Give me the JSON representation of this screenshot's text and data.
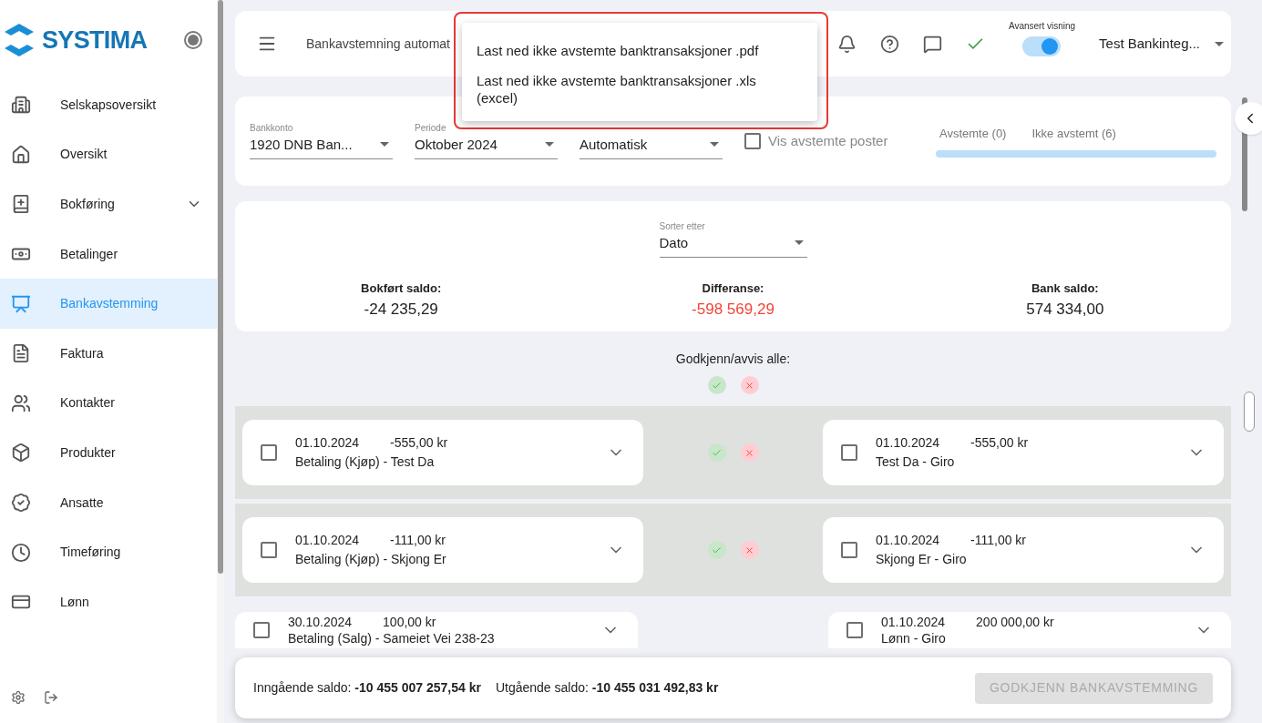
{
  "brand": "SYSTIMA",
  "sidebar": {
    "items": [
      {
        "label": "Selskapsoversikt",
        "selected": false,
        "expandable": false
      },
      {
        "label": "Oversikt",
        "selected": false,
        "expandable": false
      },
      {
        "label": "Bokføring",
        "selected": false,
        "expandable": true
      },
      {
        "label": "Betalinger",
        "selected": false,
        "expandable": false
      },
      {
        "label": "Bankavstemming",
        "selected": true,
        "expandable": false
      },
      {
        "label": "Faktura",
        "selected": false,
        "expandable": false
      },
      {
        "label": "Kontakter",
        "selected": false,
        "expandable": false
      },
      {
        "label": "Produkter",
        "selected": false,
        "expandable": false
      },
      {
        "label": "Ansatte",
        "selected": false,
        "expandable": false
      },
      {
        "label": "Timeføring",
        "selected": false,
        "expandable": false
      },
      {
        "label": "Lønn",
        "selected": false,
        "expandable": false
      }
    ]
  },
  "topbar": {
    "title": "Bankavstemning automat",
    "toggle_label": "Avansert visning",
    "toggle_on": true,
    "company": "Test Bankinteg..."
  },
  "menu": {
    "items": [
      "Last ned ikke avstemte banktransaksjoner .pdf",
      "Last ned ikke avstemte banktransaksjoner .xls (excel)"
    ]
  },
  "filters": [
    {
      "label": "Bankkonto",
      "value": "1920 DNB Ban..."
    },
    {
      "label": "Periode",
      "value": "Oktober 2024"
    },
    {
      "value": "Automatisk"
    }
  ],
  "show_reconciled": {
    "label": "Vis avstemte poster",
    "checked": false
  },
  "tabs": [
    {
      "label": "Avstemte (0)",
      "selected": false
    },
    {
      "label": "Ikke avstemt (6)",
      "selected": false
    }
  ],
  "sort": {
    "label": "Sorter etter",
    "value": "Dato"
  },
  "balances": [
    {
      "label": "Bokført saldo:",
      "value": "-24 235,29",
      "negative_highlight": false
    },
    {
      "label": "Differanse:",
      "value": "-598 569,29",
      "negative_highlight": true
    },
    {
      "label": "Bank saldo:",
      "value": "574 334,00",
      "negative_highlight": false
    }
  ],
  "approve_all_label": "Godkjenn/avvis alle:",
  "pairs": [
    {
      "matched": true,
      "left": {
        "date": "01.10.2024",
        "amount": "-555,00 kr",
        "text": "Betaling (Kjøp) - Test Da",
        "checked": false
      },
      "right": {
        "date": "01.10.2024",
        "amount": "-555,00 kr",
        "text": "Test Da - Giro",
        "checked": false
      }
    },
    {
      "matched": true,
      "left": {
        "date": "01.10.2024",
        "amount": "-111,00 kr",
        "text": "Betaling (Kjøp) - Skjong Er",
        "checked": false
      },
      "right": {
        "date": "01.10.2024",
        "amount": "-111,00 kr",
        "text": "Skjong Er - Giro",
        "checked": false
      }
    },
    {
      "matched": false,
      "left": {
        "date": "30.10.2024",
        "amount": "100,00 kr",
        "text": "Betaling (Salg) - Sameiet Vei 238-23",
        "checked": false
      },
      "right": {
        "date": "01.10.2024",
        "amount": "200 000,00 kr",
        "text": "Lønn - Giro",
        "checked": false
      }
    }
  ],
  "footer": {
    "opening_label": "Inngående saldo:",
    "opening_value": "-10 455 007 257,54 kr",
    "closing_label": "Utgående saldo:",
    "closing_value": "-10 455 031 492,83 kr",
    "button": "GODKJENN BANKAVSTEMMING",
    "button_disabled": true
  }
}
